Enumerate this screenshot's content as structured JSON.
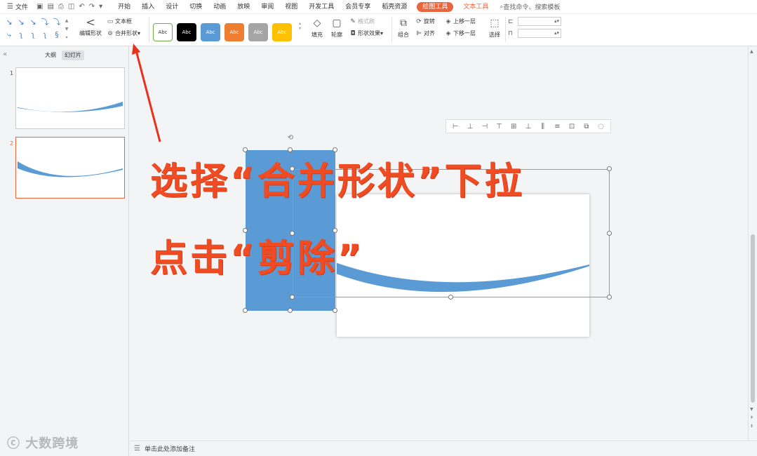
{
  "menubar": {
    "file_label": "文件",
    "tabs": [
      "开始",
      "插入",
      "设计",
      "切换",
      "动画",
      "放映",
      "审阅",
      "视图",
      "开发工具",
      "会员专享",
      "稻壳资源"
    ],
    "drawing_tab": "绘图工具",
    "text_tab": "文本工具",
    "search_placeholder": "查找命令、搜索模板"
  },
  "ribbon": {
    "edit_shape": "编辑形状",
    "text_box": "文本框",
    "merge_shapes": "合并形状",
    "style_label": "Abc",
    "styles": [
      {
        "bg": "#ffffff",
        "border": "#70ad47",
        "color": "#333333"
      },
      {
        "bg": "#000000",
        "border": "#000000",
        "color": "#ffffff"
      },
      {
        "bg": "#5b9bd5",
        "border": "#5b9bd5",
        "color": "#ffffff"
      },
      {
        "bg": "#ed7d31",
        "border": "#ed7d31",
        "color": "#ffffff"
      },
      {
        "bg": "#a5a5a5",
        "border": "#a5a5a5",
        "color": "#ffffff"
      },
      {
        "bg": "#ffc000",
        "border": "#ffc000",
        "color": "#ffffff"
      }
    ],
    "fill": "填充",
    "outline": "轮廓",
    "format_brush": "格式刷",
    "shape_effects": "形状效果",
    "group": "组合",
    "rotate": "旋转",
    "align": "对齐",
    "bring_forward": "上移一层",
    "send_backward": "下移一层",
    "select": "选择"
  },
  "panel": {
    "outline_tab": "大纲",
    "slides_tab": "幻灯片",
    "slides": [
      {
        "num": "1",
        "active": false
      },
      {
        "num": "2",
        "active": true
      }
    ]
  },
  "overlay": {
    "line1": "选择“合并形状”下拉",
    "line2": "点击“剪除”"
  },
  "notes": {
    "placeholder": "单击此处添加备注"
  },
  "watermark": "大数跨境",
  "colors": {
    "accent": "#e8663e",
    "shape_blue": "#5b9bd5",
    "annotation_red": "#f04c24"
  }
}
